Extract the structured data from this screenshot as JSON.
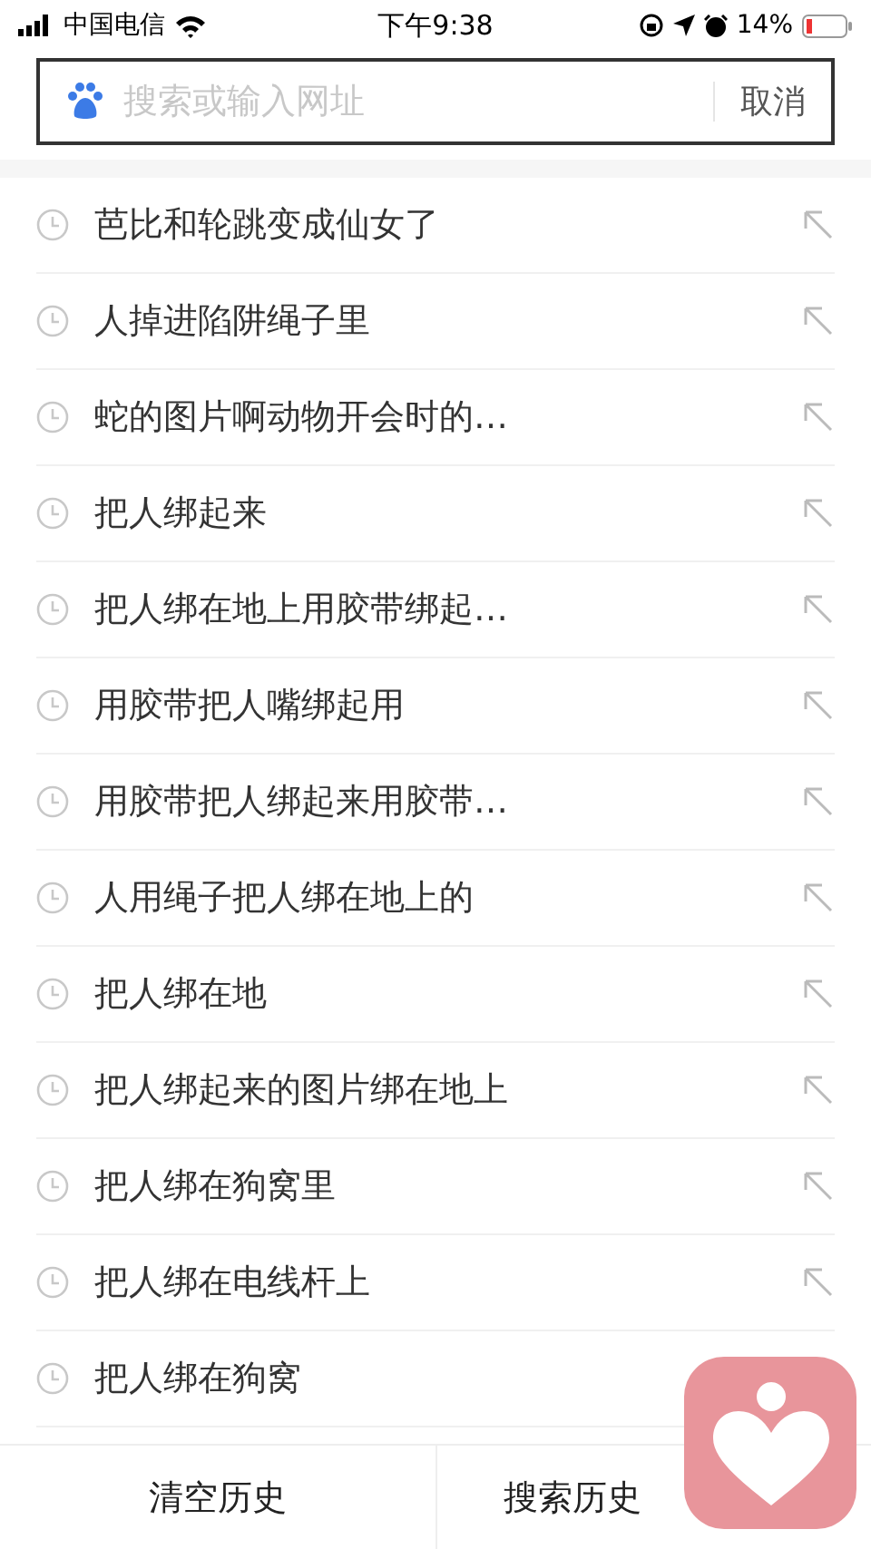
{
  "status_bar": {
    "carrier": "中国电信",
    "time": "下午9:38",
    "battery": "14%"
  },
  "search": {
    "placeholder": "搜索或输入网址",
    "cancel": "取消"
  },
  "history": [
    {
      "text": "芭比和轮跳变成仙女了"
    },
    {
      "text": "人掉进陷阱绳子里"
    },
    {
      "text": "蛇的图片啊动物开会时的…"
    },
    {
      "text": "把人绑起来"
    },
    {
      "text": "把人绑在地上用胶带绑起…"
    },
    {
      "text": "用胶带把人嘴绑起用"
    },
    {
      "text": "用胶带把人绑起来用胶带…"
    },
    {
      "text": "人用绳子把人绑在地上的"
    },
    {
      "text": "把人绑在地"
    },
    {
      "text": "把人绑起来的图片绑在地上"
    },
    {
      "text": "把人绑在狗窝里"
    },
    {
      "text": "把人绑在电线杆上"
    },
    {
      "text": "把人绑在狗窝"
    }
  ],
  "bottom_bar": [
    "清空历史",
    "搜索历史"
  ]
}
